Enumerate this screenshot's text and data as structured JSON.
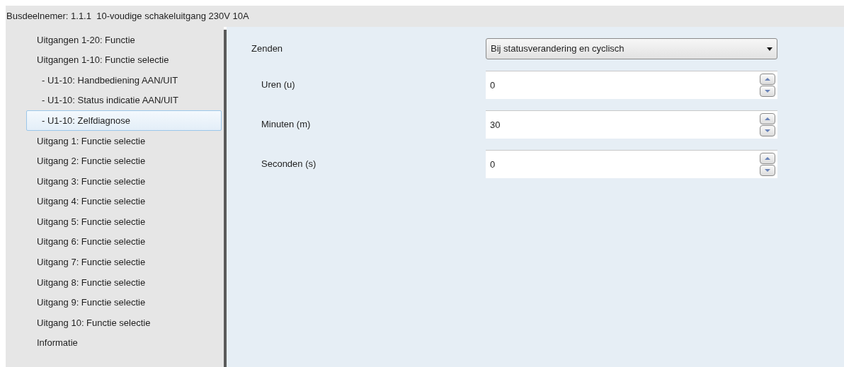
{
  "header": {
    "title": "Busdeelnemer: 1.1.1  10-voudige schakeluitgang 230V 10A"
  },
  "sidebar": {
    "items": [
      {
        "label": "Uitgangen 1-20: Functie",
        "selected": false
      },
      {
        "label": "Uitgangen 1-10: Functie selectie",
        "selected": false,
        "children": [
          {
            "label": "- U1-10: Handbediening AAN/UIT",
            "selected": false
          },
          {
            "label": "- U1-10: Status indicatie AAN/UIT",
            "selected": false
          },
          {
            "label": "- U1-10: Zelfdiagnose",
            "selected": true
          }
        ]
      },
      {
        "label": "Uitgang 1: Functie selectie",
        "selected": false
      },
      {
        "label": "Uitgang 2: Functie selectie",
        "selected": false
      },
      {
        "label": "Uitgang 3: Functie selectie",
        "selected": false
      },
      {
        "label": "Uitgang 4: Functie selectie",
        "selected": false
      },
      {
        "label": "Uitgang 5: Functie selectie",
        "selected": false
      },
      {
        "label": "Uitgang 6: Functie selectie",
        "selected": false
      },
      {
        "label": "Uitgang 7: Functie selectie",
        "selected": false
      },
      {
        "label": "Uitgang 8: Functie selectie",
        "selected": false
      },
      {
        "label": "Uitgang 9: Functie selectie",
        "selected": false
      },
      {
        "label": "Uitgang 10: Functie selectie",
        "selected": false
      },
      {
        "label": "Informatie",
        "selected": false
      }
    ]
  },
  "parameters": [
    {
      "kind": "dropdown",
      "label": "Zenden",
      "value": "Bij statusverandering en cyclisch"
    },
    {
      "kind": "spinner",
      "label": "Uren (u)",
      "value": "0"
    },
    {
      "kind": "spinner",
      "label": "Minuten (m)",
      "value": "30"
    },
    {
      "kind": "spinner",
      "label": "Seconden (s)",
      "value": "0"
    }
  ]
}
